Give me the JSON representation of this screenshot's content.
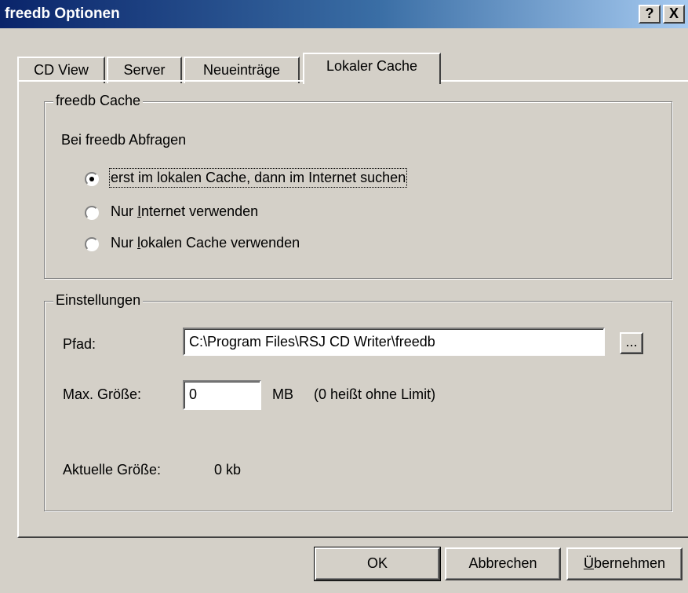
{
  "window": {
    "title": "freedb Optionen",
    "help_label": "?",
    "close_label": "X"
  },
  "tabs": [
    {
      "label": "CD View"
    },
    {
      "label": "Server"
    },
    {
      "label": "Neueinträge"
    },
    {
      "label": "Lokaler Cache",
      "active": true
    }
  ],
  "cache_group": {
    "legend": "freedb Cache",
    "prompt": "Bei freedb Abfragen",
    "options": [
      {
        "label": "erst im lokalen Cache, dann im Internet suchen",
        "selected": true
      },
      {
        "label_pre": "Nur ",
        "label_mnemonic": "I",
        "label_post": "nternet verwenden",
        "selected": false
      },
      {
        "label_pre": "Nur ",
        "label_mnemonic": "l",
        "label_post": "okalen Cache verwenden",
        "selected": false
      }
    ]
  },
  "settings_group": {
    "legend": "Einstellungen",
    "path_label": "Pfad:",
    "path_value": "C:\\Program Files\\RSJ CD Writer\\freedb",
    "browse_label": "...",
    "maxsize_label": "Max. Größe:",
    "maxsize_value": "0",
    "maxsize_unit": "MB",
    "maxsize_hint": "(0 heißt ohne Limit)",
    "current_label": "Aktuelle Größe:",
    "current_value": "0 kb"
  },
  "buttons": {
    "ok": "OK",
    "cancel": "Abbrechen",
    "apply_mnemonic": "Ü",
    "apply_rest": "bernehmen"
  }
}
